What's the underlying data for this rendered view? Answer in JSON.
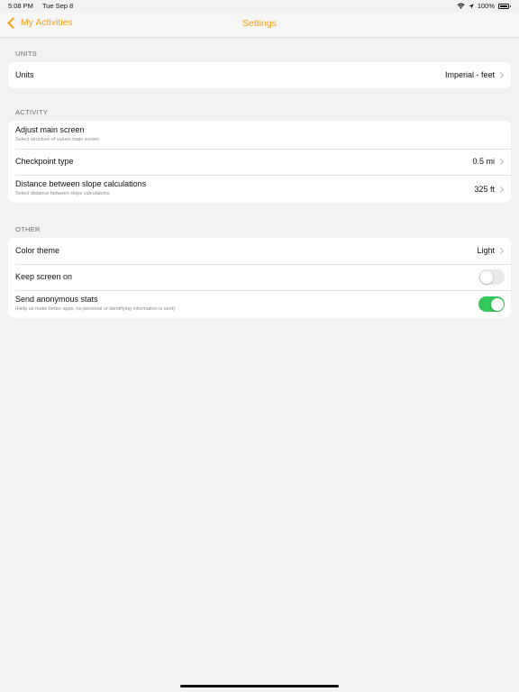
{
  "status_bar": {
    "time": "5:08 PM",
    "date": "Tue Sep 8",
    "battery": "100%",
    "icons": [
      "wifi-icon",
      "location-icon",
      "battery-icon"
    ]
  },
  "nav": {
    "back_label": "My Activities",
    "title": "Settings"
  },
  "colors": {
    "accent": "#f5a018",
    "toggle_on": "#34c759",
    "background": "#f2f2f4"
  },
  "sections": {
    "units": {
      "header": "UNITS",
      "rows": [
        {
          "title": "Units",
          "value": "Imperial - feet"
        }
      ]
    },
    "activity": {
      "header": "ACTIVITY",
      "rows": [
        {
          "title": "Adjust main screen",
          "subtitle": "Select structure of values main screen"
        },
        {
          "title": "Checkpoint type",
          "value": "0.5 mi"
        },
        {
          "title": "Distance between slope calculations",
          "subtitle": "Select distance between slope calculations",
          "value": "325 ft"
        }
      ]
    },
    "other": {
      "header": "OTHER",
      "rows": [
        {
          "title": "Color theme",
          "value": "Light"
        },
        {
          "title": "Keep screen on",
          "toggle": false
        },
        {
          "title": "Send anonymous stats",
          "subtitle": "(Help us make better apps, no personal or identifying information is sent)",
          "toggle": true
        }
      ]
    }
  }
}
